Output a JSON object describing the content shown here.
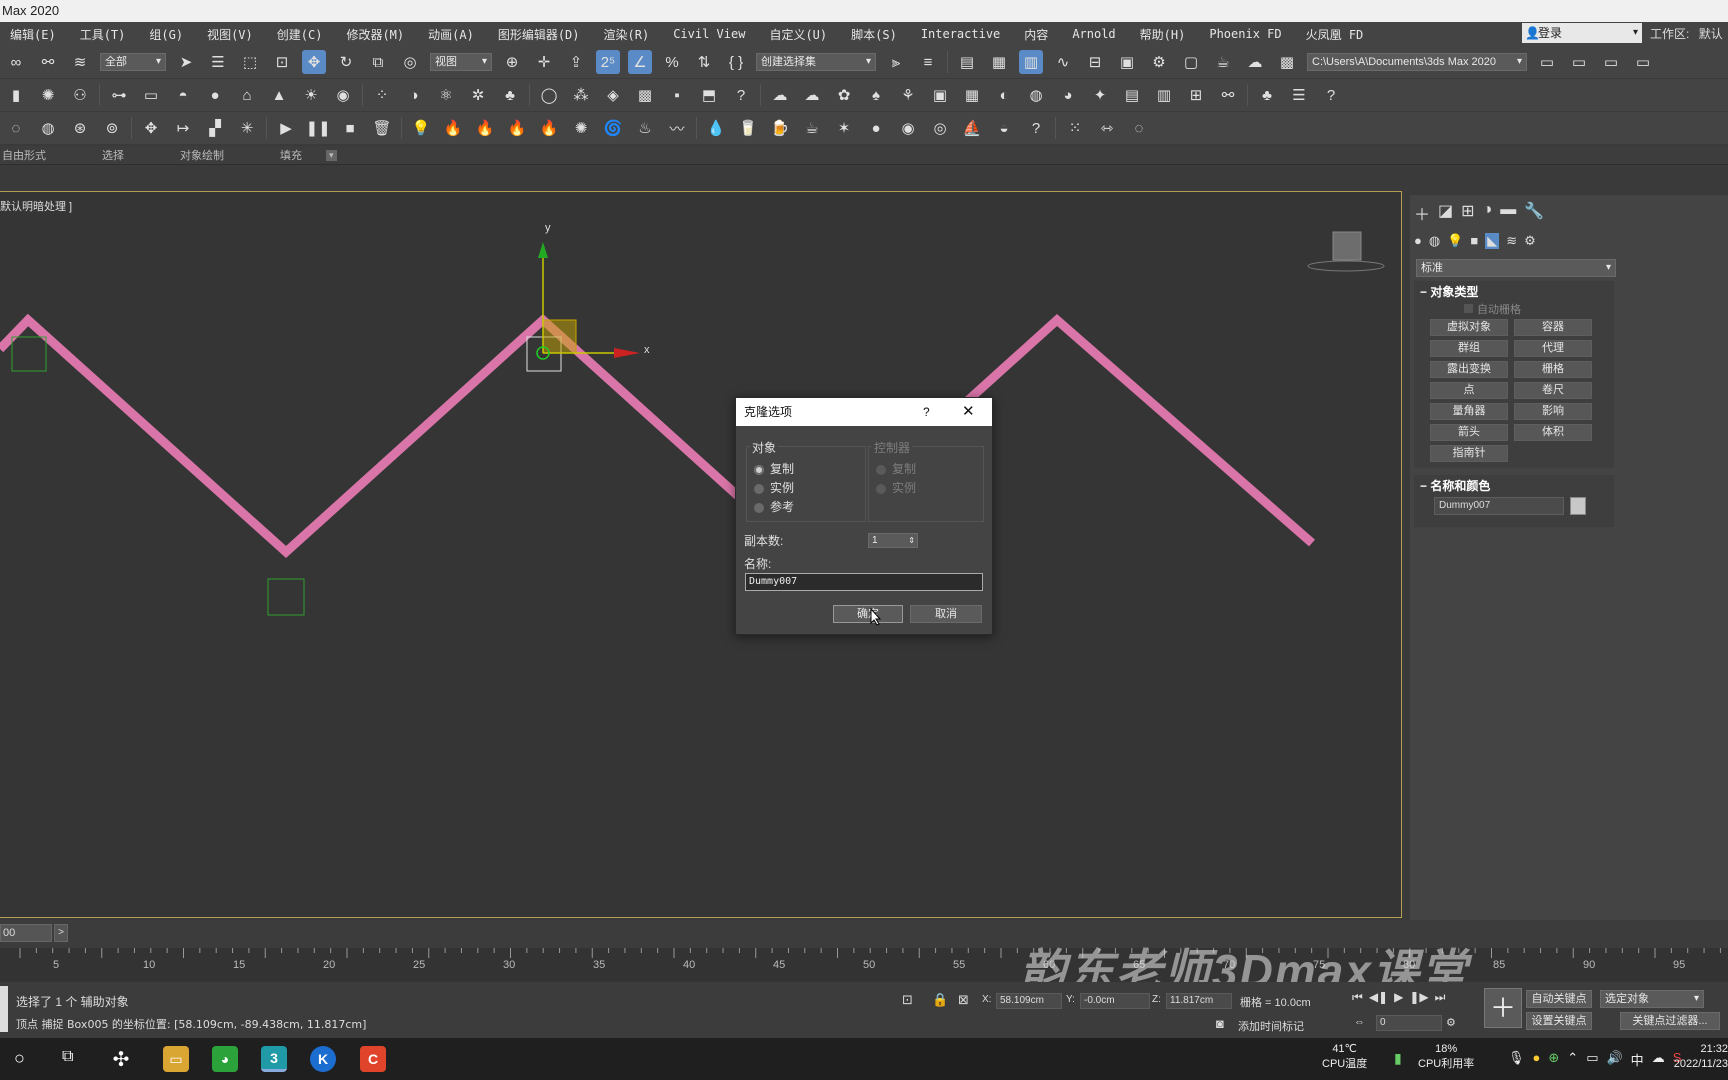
{
  "window": {
    "title": "Max 2020"
  },
  "menu": [
    "编辑(E)",
    "工具(T)",
    "组(G)",
    "视图(V)",
    "创建(C)",
    "修改器(M)",
    "动画(A)",
    "图形编辑器(D)",
    "渲染(R)",
    "Civil View",
    "自定义(U)",
    "脚本(S)",
    "Interactive",
    "内容",
    "Arnold",
    "帮助(H)",
    "Phoenix FD",
    "火凤凰 FD"
  ],
  "account": {
    "login": "登录",
    "workspace_label": "工作区:",
    "workspace_value": "默认"
  },
  "toolbar1": {
    "filter_select": "全部",
    "ref_coord": "视图",
    "selection_set": "创建选择集",
    "project_path": "C:\\Users\\A\\Documents\\3ds Max 2020"
  },
  "ribbon": {
    "tabs": [
      "自由形式",
      "选择",
      "对象绘制",
      "填充"
    ]
  },
  "viewport": {
    "label": "默认明暗处理 ]",
    "gizmo_y": "y",
    "gizmo_x": "x"
  },
  "cmdpanel": {
    "category": "标准",
    "object_type_title": "对象类型",
    "auto_grid": "自动栅格",
    "buttons": [
      "虚拟对象",
      "容器",
      "群组",
      "代理",
      "露出变换",
      "栅格",
      "点",
      "卷尺",
      "量角器",
      "影响",
      "箭头",
      "体积",
      "指南针"
    ],
    "name_color_title": "名称和颜色",
    "name_value": "Dummy007"
  },
  "dialog": {
    "title": "克隆选项",
    "help": "?",
    "object_group": "对象",
    "object_options": [
      "复制",
      "实例",
      "参考"
    ],
    "controller_group": "控制器",
    "controller_options": [
      "复制",
      "实例"
    ],
    "copies_label": "副本数:",
    "copies_value": "1",
    "name_label": "名称:",
    "name_value": "Dummy007",
    "ok": "确定",
    "cancel": "取消"
  },
  "timeline": {
    "frame_field": "00",
    "ticks": [
      "5",
      "10",
      "15",
      "20",
      "25",
      "30",
      "35",
      "40",
      "45",
      "50",
      "55",
      "60",
      "65",
      "70",
      "75",
      "80",
      "85",
      "90",
      "95"
    ]
  },
  "status": {
    "line1": "选择了 1 个 辅助对象",
    "line2": "顶点 捕捉 Box005 的坐标位置: [58.109cm, -89.438cm, 11.817cm]",
    "x_label": "X:",
    "x": "58.109cm",
    "y_label": "Y:",
    "y": "-0.0cm",
    "z_label": "Z:",
    "z": "11.817cm",
    "grid": "栅格 = 10.0cm",
    "add_time_tag": "添加时间标记",
    "auto_key": "自动关键点",
    "selected_object": "选定对象",
    "set_key": "设置关键点",
    "key_filter": "关键点过滤器...",
    "frame_value": "0"
  },
  "watermark": "韵东老师3Dmax课堂",
  "taskbar": {
    "cpu_temp": "41℃",
    "cpu_temp_label": "CPU温度",
    "cpu_usage": "18%",
    "cpu_usage_label": "CPU利用率",
    "ime": "中",
    "time": "21:32",
    "date": "2022/11/23"
  },
  "colors": {
    "shape_line": "#d975a8",
    "accent": "#5b8bc7",
    "viewport_border": "#b59e50"
  }
}
